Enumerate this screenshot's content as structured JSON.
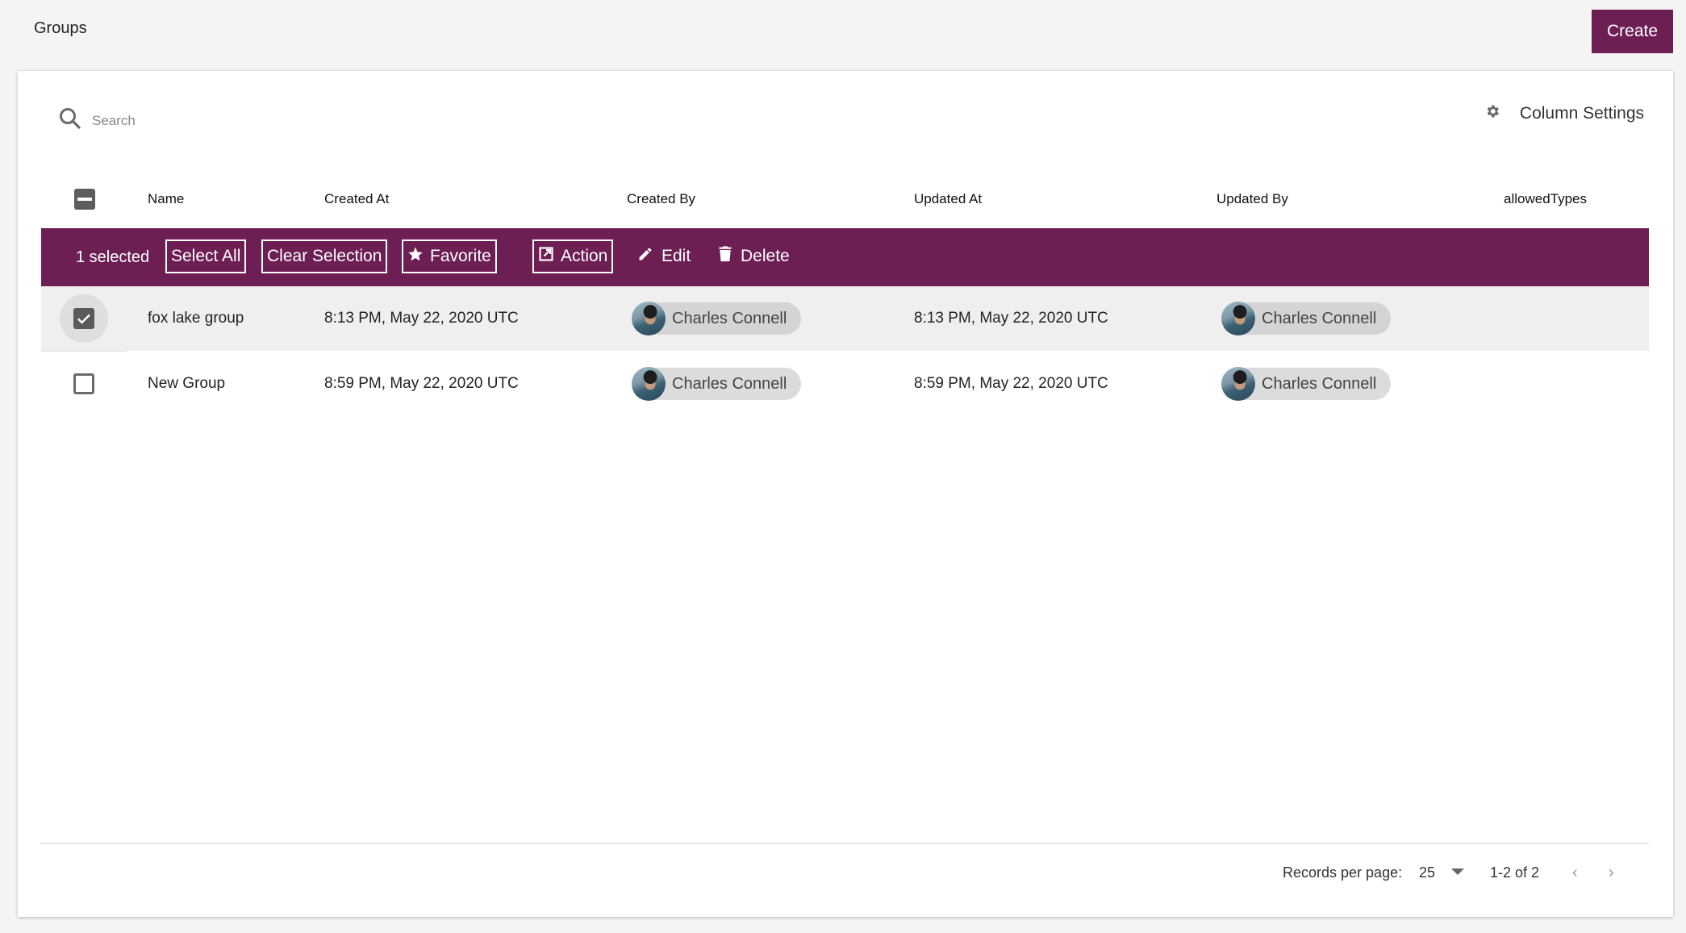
{
  "header": {
    "title": "Groups",
    "create_label": "Create"
  },
  "toolbar": {
    "search_placeholder": "Search",
    "search_value": "",
    "column_settings_label": "Column Settings"
  },
  "table": {
    "columns": [
      "Name",
      "Created At",
      "Created By",
      "Updated At",
      "Updated By",
      "allowedTypes"
    ],
    "action_bar": {
      "selected_count": "1 selected",
      "select_all": "Select All",
      "clear_selection": "Clear Selection",
      "favorite": "Favorite",
      "action": "Action",
      "edit": "Edit",
      "delete": "Delete"
    },
    "rows": [
      {
        "selected": true,
        "name": "fox lake group",
        "created_at": "8:13 PM, May 22, 2020 UTC",
        "created_by": "Charles Connell",
        "updated_at": "8:13 PM, May 22, 2020 UTC",
        "updated_by": "Charles Connell",
        "allowed_types": ""
      },
      {
        "selected": false,
        "name": "New Group",
        "created_at": "8:59 PM, May 22, 2020 UTC",
        "created_by": "Charles Connell",
        "updated_at": "8:59 PM, May 22, 2020 UTC",
        "updated_by": "Charles Connell",
        "allowed_types": ""
      }
    ]
  },
  "pagination": {
    "records_label": "Records per page:",
    "per_page": "25",
    "range": "1-2 of 2",
    "prev_icon": "‹",
    "next_icon": "›"
  },
  "theme": {
    "accent": "#6d1f54",
    "selected_row": "#efefef",
    "background": "#f4f4f4"
  }
}
